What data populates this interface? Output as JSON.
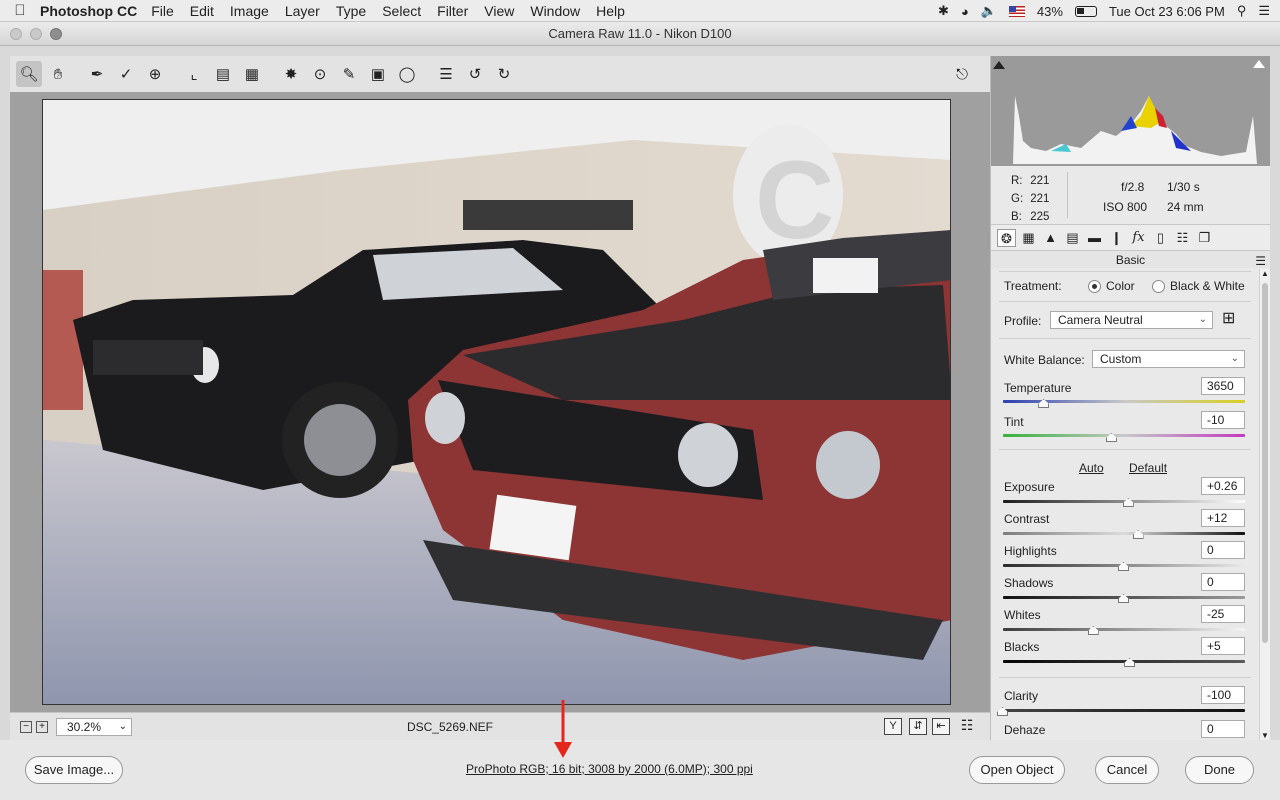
{
  "menubar": {
    "app": "Photoshop CC",
    "items": [
      "File",
      "Edit",
      "Image",
      "Layer",
      "Type",
      "Select",
      "Filter",
      "View",
      "Window",
      "Help"
    ],
    "battery": "43%",
    "clock": "Tue Oct 23  6:06 PM"
  },
  "window": {
    "title": "Camera Raw 11.0  -  Nikon D100"
  },
  "toolbar": {
    "tools": [
      "zoom-icon",
      "hand-icon",
      "white-balance-icon",
      "color-sampler-icon",
      "target-adjust-icon",
      "crop-icon",
      "straighten-icon",
      "transform-icon",
      "spot-removal-icon",
      "red-eye-icon",
      "adjustment-brush-icon",
      "graduated-filter-icon",
      "radial-filter-icon",
      "list-icon",
      "rotate-left-icon",
      "rotate-right-icon"
    ]
  },
  "preview": {
    "zoom": "30.2%",
    "filename": "DSC_5269.NEF",
    "view_toggle_label": "Y"
  },
  "histogram_info": {
    "r_label": "R:",
    "r": "221",
    "g_label": "G:",
    "g": "221",
    "b_label": "B:",
    "b": "225",
    "aperture": "f/2.8",
    "shutter": "1/30 s",
    "iso": "ISO 800",
    "focal": "24 mm"
  },
  "panel": {
    "title": "Basic",
    "treatment_label": "Treatment:",
    "treatment_color": "Color",
    "treatment_bw": "Black & White",
    "profile_label": "Profile:",
    "profile_value": "Camera Neutral",
    "wb_label": "White Balance:",
    "wb_value": "Custom",
    "auto": "Auto",
    "default": "Default",
    "sliders": {
      "temperature": {
        "label": "Temperature",
        "value": "3650",
        "pos": 0.17
      },
      "tint": {
        "label": "Tint",
        "value": "-10",
        "pos": 0.45
      },
      "exposure": {
        "label": "Exposure",
        "value": "+0.26",
        "pos": 0.52
      },
      "contrast": {
        "label": "Contrast",
        "value": "+12",
        "pos": 0.56
      },
      "highlights": {
        "label": "Highlights",
        "value": "0",
        "pos": 0.5
      },
      "shadows": {
        "label": "Shadows",
        "value": "0",
        "pos": 0.5
      },
      "whites": {
        "label": "Whites",
        "value": "-25",
        "pos": 0.375
      },
      "blacks": {
        "label": "Blacks",
        "value": "+5",
        "pos": 0.525
      },
      "clarity": {
        "label": "Clarity",
        "value": "-100",
        "pos": 0.0
      },
      "dehaze": {
        "label": "Dehaze",
        "value": "0",
        "pos": 0.5
      }
    }
  },
  "bottombar": {
    "save": "Save Image...",
    "workflow_options": "ProPhoto RGB; 16 bit; 3008 by 2000 (6.0MP); 300 ppi",
    "open": "Open Object",
    "cancel": "Cancel",
    "done": "Done"
  },
  "colors": {
    "annotation_arrow": "#e5261c"
  }
}
